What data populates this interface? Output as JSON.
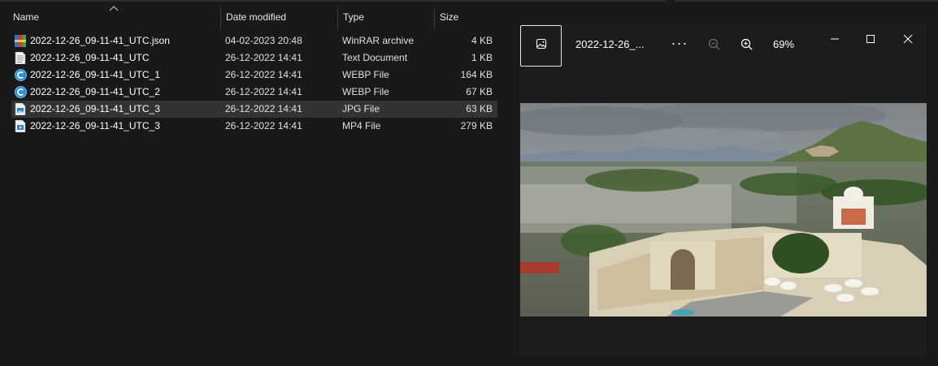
{
  "explorer": {
    "columns": {
      "name": "Name",
      "date_modified": "Date modified",
      "type": "Type",
      "size": "Size"
    },
    "sort_icon": "chevron-up-icon",
    "files": [
      {
        "name": "2022-12-26_09-11-41_UTC.json",
        "date": "04-02-2023 20:48",
        "type": "WinRAR archive",
        "size": "4 KB",
        "icon": "winrar-archive-icon",
        "selected": false
      },
      {
        "name": "2022-12-26_09-11-41_UTC",
        "date": "26-12-2022 14:41",
        "type": "Text Document",
        "size": "1 KB",
        "icon": "text-document-icon",
        "selected": false
      },
      {
        "name": "2022-12-26_09-11-41_UTC_1",
        "date": "26-12-2022 14:41",
        "type": "WEBP File",
        "size": "164 KB",
        "icon": "webp-file-icon",
        "selected": false
      },
      {
        "name": "2022-12-26_09-11-41_UTC_2",
        "date": "26-12-2022 14:41",
        "type": "WEBP File",
        "size": "67 KB",
        "icon": "webp-file-icon",
        "selected": false
      },
      {
        "name": "2022-12-26_09-11-41_UTC_3",
        "date": "26-12-2022 14:41",
        "type": "JPG File",
        "size": "63 KB",
        "icon": "jpg-file-icon",
        "selected": true
      },
      {
        "name": "2022-12-26_09-11-41_UTC_3",
        "date": "26-12-2022 14:41",
        "type": "MP4 File",
        "size": "279 KB",
        "icon": "mp4-file-icon",
        "selected": false
      }
    ]
  },
  "viewer": {
    "title": "2022-12-26_...",
    "more_label": "···",
    "zoom_level": "69%",
    "icons": {
      "gallery": "gallery-icon",
      "zoom_out": "zoom-out-icon",
      "zoom_in": "zoom-in-icon",
      "minimize": "minimize-icon",
      "maximize": "maximize-icon",
      "close": "close-icon"
    },
    "photo_description_icon": "city-palace-photo"
  },
  "colors": {
    "background": "#191919",
    "selected_row": "#333333",
    "viewer_bg": "#1c1c1c",
    "text": "#ffffff"
  }
}
